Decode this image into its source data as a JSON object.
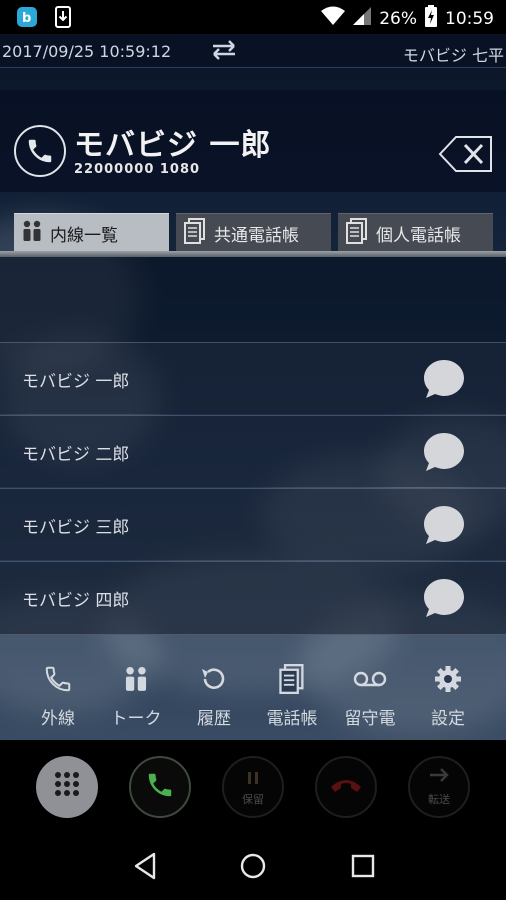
{
  "status_bar": {
    "battery_percent": "26%",
    "time": "10:59",
    "left_icons": [
      "bluetooth-b-icon",
      "download-icon"
    ],
    "right_icons": [
      "wifi-icon",
      "signal-icon",
      "battery-charging-icon"
    ]
  },
  "info_bar": {
    "datetime": "2017/09/25 10:59:12",
    "switch_icon": "swap-arrows-icon",
    "user_label": "モバビジ 七平"
  },
  "callee": {
    "name": "モバビジ 一郎",
    "number": "22000000 1080",
    "phone_icon": "phone-circle-icon",
    "clear_icon": "backspace-icon"
  },
  "tabs": [
    {
      "label": "内線一覧",
      "icon": "people-icon",
      "active": true
    },
    {
      "label": "共通電話帳",
      "icon": "document-icon",
      "active": false
    },
    {
      "label": "個人電話帳",
      "icon": "document-icon",
      "active": false
    }
  ],
  "contacts": [
    {
      "name": "モバビジ 一郎"
    },
    {
      "name": "モバビジ 二郎"
    },
    {
      "name": "モバビジ 三郎"
    },
    {
      "name": "モバビジ 四郎"
    }
  ],
  "actions": [
    {
      "label": "外線",
      "icon": "phone-icon"
    },
    {
      "label": "トーク",
      "icon": "people-icon"
    },
    {
      "label": "履歴",
      "icon": "history-icon"
    },
    {
      "label": "電話帳",
      "icon": "phonebook-icon"
    },
    {
      "label": "留守電",
      "icon": "voicemail-icon"
    },
    {
      "label": "設定",
      "icon": "gear-icon"
    }
  ],
  "call_controls": {
    "dialpad_icon": "dialpad-icon",
    "call_icon": "phone-call-icon",
    "hold_label": "保留",
    "hangup_icon": "hangup-icon",
    "transfer_label": "転送"
  },
  "colors": {
    "accent_green": "#4caf50",
    "hangup_red": "#5a1010",
    "tab_active": "#b8bdc4"
  }
}
